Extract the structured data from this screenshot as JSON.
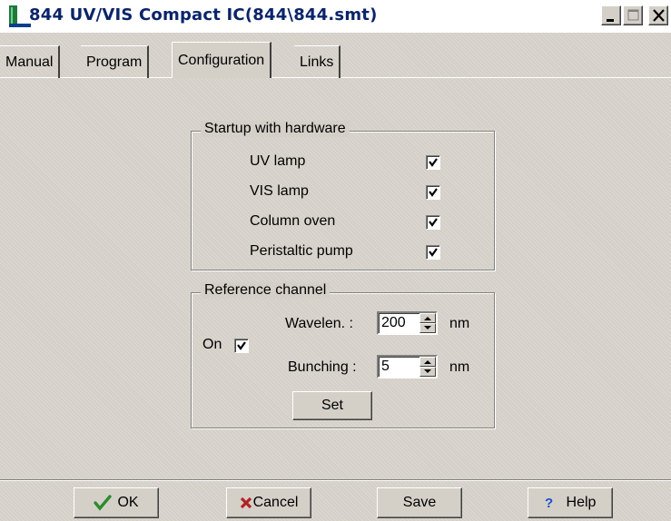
{
  "window": {
    "title": "844 UV/VIS Compact IC(844\\844.smt)"
  },
  "tabs": [
    {
      "label": "Manual"
    },
    {
      "label": "Program"
    },
    {
      "label": "Configuration",
      "active": true
    },
    {
      "label": "Links"
    }
  ],
  "startup": {
    "title": "Startup with hardware",
    "items": [
      {
        "label": "UV lamp",
        "checked": true
      },
      {
        "label": "VIS lamp",
        "checked": true
      },
      {
        "label": "Column oven",
        "checked": true
      },
      {
        "label": "Peristaltic pump",
        "checked": true
      }
    ]
  },
  "reference": {
    "title": "Reference channel",
    "on_label": "On",
    "on_checked": true,
    "wavelength_label": "Wavelen. :",
    "wavelength_value": "200",
    "wavelength_unit": "nm",
    "bunching_label": "Bunching :",
    "bunching_value": "5",
    "bunching_unit": "nm",
    "set_label": "Set"
  },
  "footer": {
    "ok_label": "OK",
    "cancel_label": "Cancel",
    "save_label": "Save",
    "help_label": "Help"
  },
  "colors": {
    "title_text": "#0a246a",
    "ok_icon": "#2e8b2e",
    "cancel_icon": "#b22222",
    "help_icon": "#1e50c8"
  },
  "icons": {
    "app": "app-icon",
    "minimize": "minimize-icon",
    "maximize": "maximize-icon",
    "close": "close-icon",
    "ok": "checkmark-icon",
    "cancel": "x-icon",
    "help": "question-icon"
  }
}
